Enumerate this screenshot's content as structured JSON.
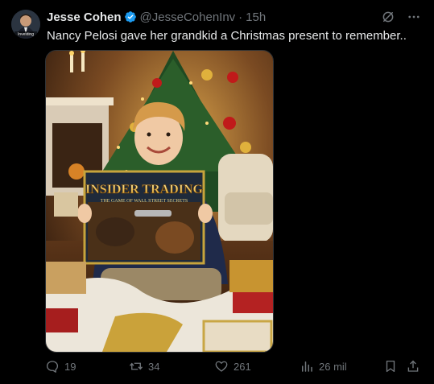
{
  "tweet": {
    "author_name": "Jesse Cohen",
    "handle": "@JesseCohenInv",
    "separator": "·",
    "time": "15h",
    "text": "Nancy Pelosi gave her grandkid a Christmas present to remember..",
    "avatar_badge": "Investing"
  },
  "media": {
    "box_title": "INSIDER TRADING",
    "box_subtitle": "THE GAME OF WALL STREET SECRETS"
  },
  "actions": {
    "replies": "19",
    "reposts": "34",
    "likes": "261",
    "views": "26 mil"
  },
  "colors": {
    "background": "#000000",
    "text_primary": "#e7e9ea",
    "text_secondary": "#71767b",
    "verified": "#1d9bf0"
  }
}
